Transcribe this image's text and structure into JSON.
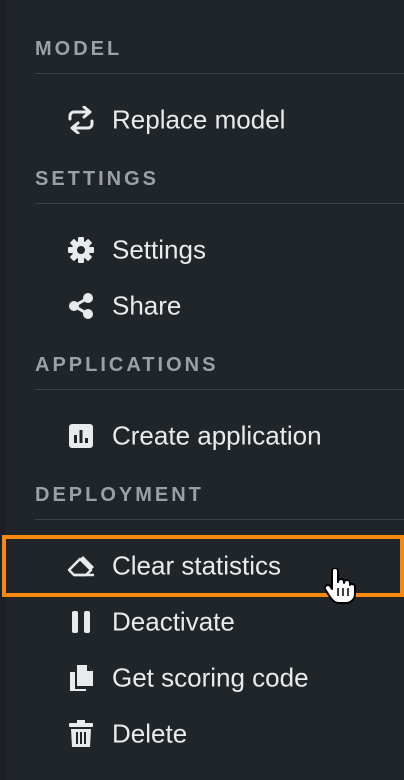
{
  "sections": {
    "model": {
      "header": "MODEL",
      "items": [
        {
          "label": "Replace model",
          "icon": "refresh-icon"
        }
      ]
    },
    "settings": {
      "header": "SETTINGS",
      "items": [
        {
          "label": "Settings",
          "icon": "gear-icon"
        },
        {
          "label": "Share",
          "icon": "share-icon"
        }
      ]
    },
    "applications": {
      "header": "APPLICATIONS",
      "items": [
        {
          "label": "Create application",
          "icon": "bar-chart-icon"
        }
      ]
    },
    "deployment": {
      "header": "DEPLOYMENT",
      "items": [
        {
          "label": "Clear statistics",
          "icon": "eraser-icon"
        },
        {
          "label": "Deactivate",
          "icon": "pause-icon"
        },
        {
          "label": "Get scoring code",
          "icon": "copy-icon"
        },
        {
          "label": "Delete",
          "icon": "trash-icon"
        }
      ]
    }
  },
  "highlight_color": "#f78a0e",
  "text_color": "#e8eaec",
  "header_color": "#9aa0a6",
  "background_color": "#20252a"
}
